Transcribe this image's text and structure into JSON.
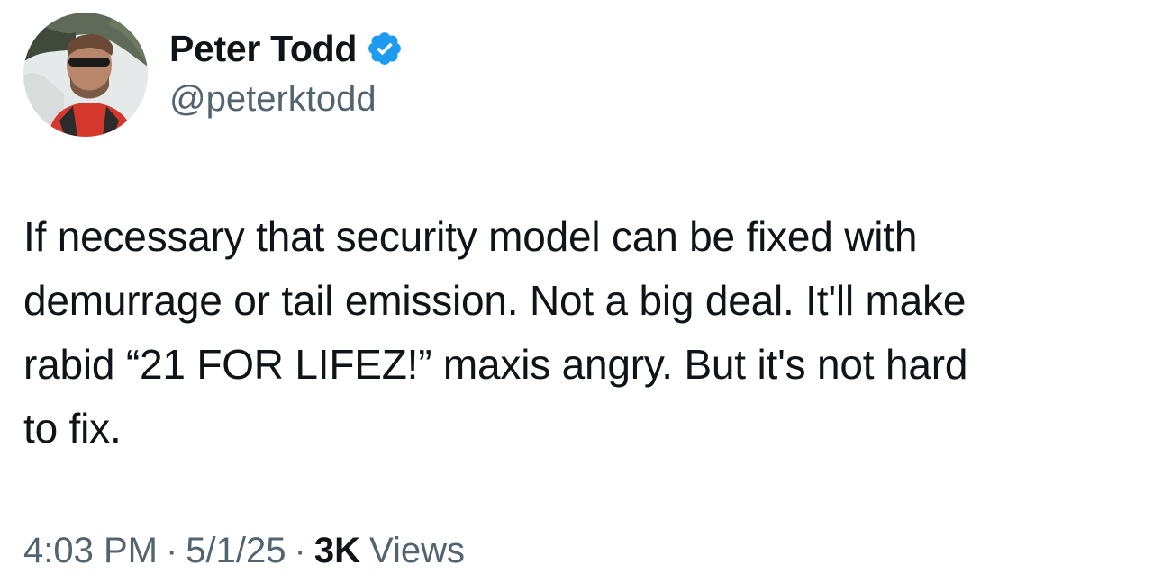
{
  "author": {
    "display_name": "Peter Todd",
    "handle": "@peterktodd",
    "verified_icon": "verified-badge-icon",
    "verified_color": "#1d9bf0"
  },
  "tweet": {
    "text": "If necessary that security model can be fixed with\ndemurrage or tail emission. Not a big deal. It'll make\nrabid “21 FOR LIFEZ!” maxis angry. But it's not hard\nto fix."
  },
  "meta": {
    "time": "4:03 PM",
    "separator": "·",
    "date": "5/1/25",
    "views_count": "3K",
    "views_label": "Views"
  },
  "colors": {
    "text_primary": "#0f1419",
    "text_secondary": "#536471",
    "background": "#ffffff"
  }
}
